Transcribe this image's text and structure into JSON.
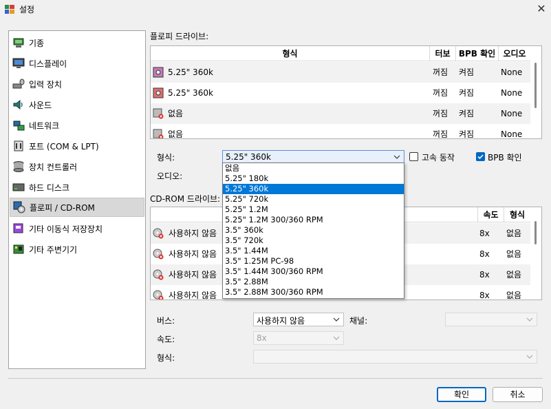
{
  "window": {
    "title": "설정"
  },
  "nav": {
    "items": [
      {
        "label": "기종",
        "icon": "machine-icon"
      },
      {
        "label": "디스플레이",
        "icon": "display-icon"
      },
      {
        "label": "입력 장치",
        "icon": "input-devices-icon"
      },
      {
        "label": "사운드",
        "icon": "sound-icon"
      },
      {
        "label": "네트워크",
        "icon": "network-icon"
      },
      {
        "label": "포트 (COM & LPT)",
        "icon": "ports-icon"
      },
      {
        "label": "장치 컨트롤러",
        "icon": "storage-controllers-icon"
      },
      {
        "label": "하드 디스크",
        "icon": "hard-disk-icon"
      },
      {
        "label": "플로피 / CD-ROM",
        "icon": "floppy-cdrom-icon"
      },
      {
        "label": "기타 이동식 저장장치",
        "icon": "removable-storage-icon"
      },
      {
        "label": "기타 주변기기",
        "icon": "other-peripherals-icon"
      }
    ],
    "selected": "플로피 / CD-ROM"
  },
  "floppy": {
    "section_label": "플로피 드라이브:",
    "columns": {
      "type": "형식",
      "turbo": "터보",
      "bpb": "BPB 확인",
      "audio": "오디오"
    },
    "rows": [
      {
        "type": "5.25\" 360k",
        "turbo": "꺼짐",
        "bpb": "켜짐",
        "audio": "None",
        "icon": "floppy-525-icon"
      },
      {
        "type": "5.25\" 360k",
        "turbo": "꺼짐",
        "bpb": "켜짐",
        "audio": "None",
        "icon": "floppy-525-icon"
      },
      {
        "type": "없음",
        "turbo": "꺼짐",
        "bpb": "켜짐",
        "audio": "None",
        "icon": "floppy-empty-icon"
      },
      {
        "type": "없음",
        "turbo": "꺼짐",
        "bpb": "켜짐",
        "audio": "None",
        "icon": "floppy-empty-icon"
      }
    ],
    "form": {
      "type_label": "형식:",
      "type_value": "5.25\" 360k",
      "turbo_label": "고속 동작",
      "turbo_checked": false,
      "bpb_label": "BPB 확인",
      "bpb_checked": true,
      "audio_label": "오디오:"
    },
    "type_options": [
      "없음",
      "5.25\" 180k",
      "5.25\" 360k",
      "5.25\" 720k",
      "5.25\" 1.2M",
      "5.25\" 1.2M 300/360 RPM",
      "3.5\" 360k",
      "3.5\" 720k",
      "3.5\" 1.44M",
      "3.5\" 1.25M PC-98",
      "3.5\" 1.44M 300/360 RPM",
      "3.5\" 2.88M",
      "3.5\" 2.88M 300/360 RPM"
    ],
    "highlighted_option": "5.25\" 360k"
  },
  "cdrom": {
    "section_label": "CD-ROM 드라이브:",
    "columns": {
      "speed": "속도",
      "type": "형식"
    },
    "rows": [
      {
        "bus": "사용하지 않음",
        "speed": "8x",
        "type": "없음",
        "icon": "cdrom-icon"
      },
      {
        "bus": "사용하지 않음",
        "speed": "8x",
        "type": "없음",
        "icon": "cdrom-icon"
      },
      {
        "bus": "사용하지 않음",
        "speed": "8x",
        "type": "없음",
        "icon": "cdrom-icon"
      },
      {
        "bus": "사용하지 않음",
        "speed": "8x",
        "type": "없음",
        "icon": "cdrom-icon"
      }
    ],
    "form": {
      "bus_label": "버스:",
      "bus_value": "사용하지 않음",
      "channel_label": "채널:",
      "channel_value": "",
      "speed_label": "속도:",
      "speed_value": "8x",
      "type_label": "형식:",
      "type_value": ""
    }
  },
  "buttons": {
    "ok": "확인",
    "cancel": "취소"
  },
  "colors": {
    "accent": "#0067c0",
    "highlight": "#0078d7",
    "selection": "#d8d8d8"
  }
}
